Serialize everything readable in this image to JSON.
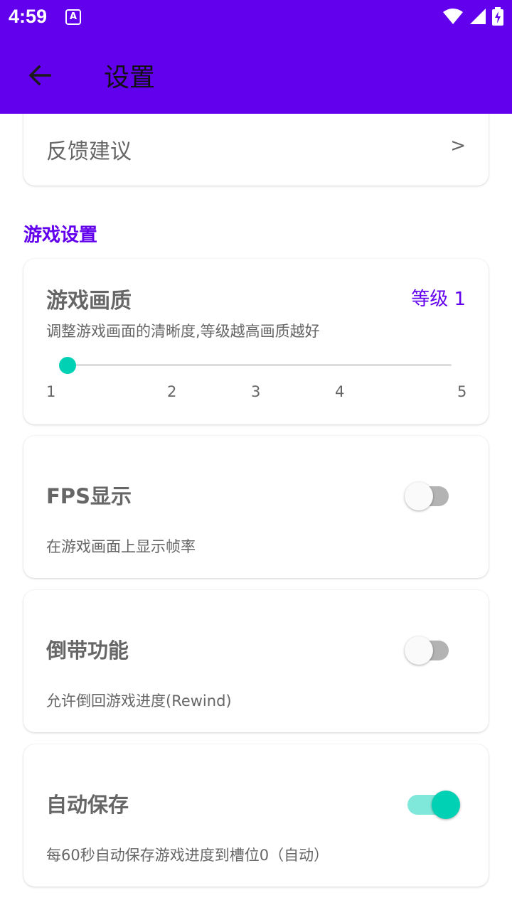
{
  "status_bar": {
    "time": "4:59",
    "notification_icon": "A",
    "icons": [
      "wifi-icon",
      "cell-signal-icon",
      "battery-charging-icon"
    ]
  },
  "app_bar": {
    "title": "设置",
    "back_icon": "arrow-left-icon",
    "background": "#6200ee"
  },
  "feedback": {
    "label": "反馈建议",
    "arrow": ">"
  },
  "section": {
    "title": "游戏设置"
  },
  "quality": {
    "title": "游戏画质",
    "level_text": "等级 1",
    "description": "调整游戏画面的清晰度,等级越高画质越好",
    "ticks": [
      "1",
      "2",
      "3",
      "4",
      "5"
    ],
    "value": 1,
    "min": 1,
    "max": 5
  },
  "toggles": [
    {
      "title": "FPS显示",
      "description": "在游戏画面上显示帧率",
      "on": false
    },
    {
      "title": "倒带功能",
      "description": "允许倒回游戏进度(Rewind)",
      "on": false
    },
    {
      "title": "自动保存",
      "description": "每60秒自动保存游戏进度到槽位0（自动）",
      "on": true
    }
  ],
  "colors": {
    "accent": "#6200ee",
    "teal": "#00d1b4",
    "text": "#666666"
  }
}
